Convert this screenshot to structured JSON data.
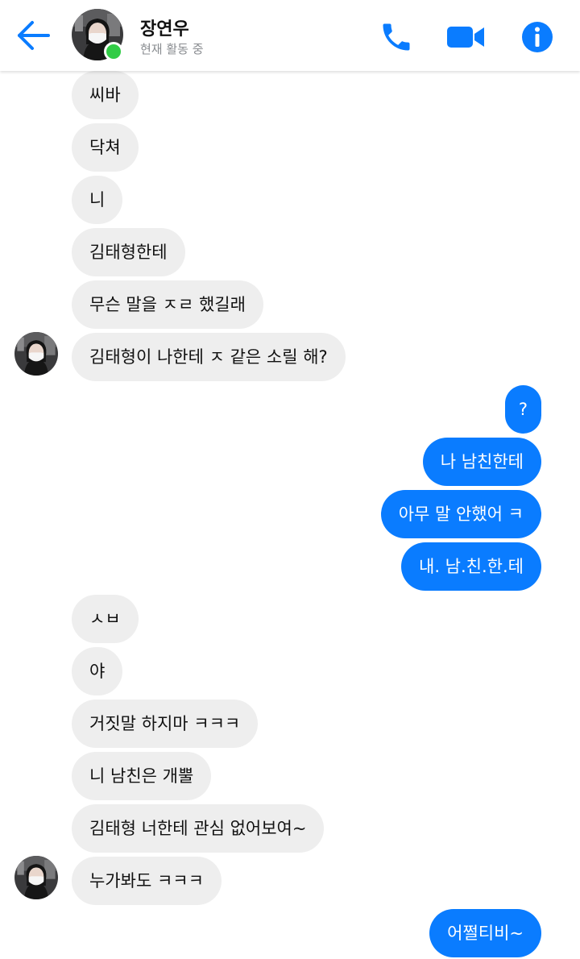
{
  "header": {
    "contact_name": "장연우",
    "status": "현재 활동 중"
  },
  "colors": {
    "accent": "#0a7cff",
    "incoming_bubble": "#eeeeee",
    "online": "#31cc46"
  },
  "icons": {
    "back": "arrow-left-icon",
    "call": "phone-icon",
    "video": "video-camera-icon",
    "info": "info-icon"
  },
  "messages": [
    {
      "from": "them",
      "text": "씨바"
    },
    {
      "from": "them",
      "text": "닥쳐"
    },
    {
      "from": "them",
      "text": "니"
    },
    {
      "from": "them",
      "text": "김태형한테"
    },
    {
      "from": "them",
      "text": "무슨 말을 ㅈㄹ 했길래"
    },
    {
      "from": "them",
      "text": "김태형이 나한테 ㅈ 같은 소릴 해?"
    },
    {
      "from": "me",
      "text": "?"
    },
    {
      "from": "me",
      "text": "나 남친한테"
    },
    {
      "from": "me",
      "text": "아무 말 안했어 ㅋ"
    },
    {
      "from": "me",
      "text": "내. 남.친.한.테"
    },
    {
      "from": "them",
      "text": "ㅅㅂ"
    },
    {
      "from": "them",
      "text": "야"
    },
    {
      "from": "them",
      "text": "거짓말 하지마 ㅋㅋㅋ"
    },
    {
      "from": "them",
      "text": "니 남친은 개뿔"
    },
    {
      "from": "them",
      "text": "김태형 너한테 관심 없어보여~"
    },
    {
      "from": "them",
      "text": "누가봐도 ㅋㅋㅋ"
    },
    {
      "from": "me",
      "text": "어쩔티비~"
    }
  ]
}
